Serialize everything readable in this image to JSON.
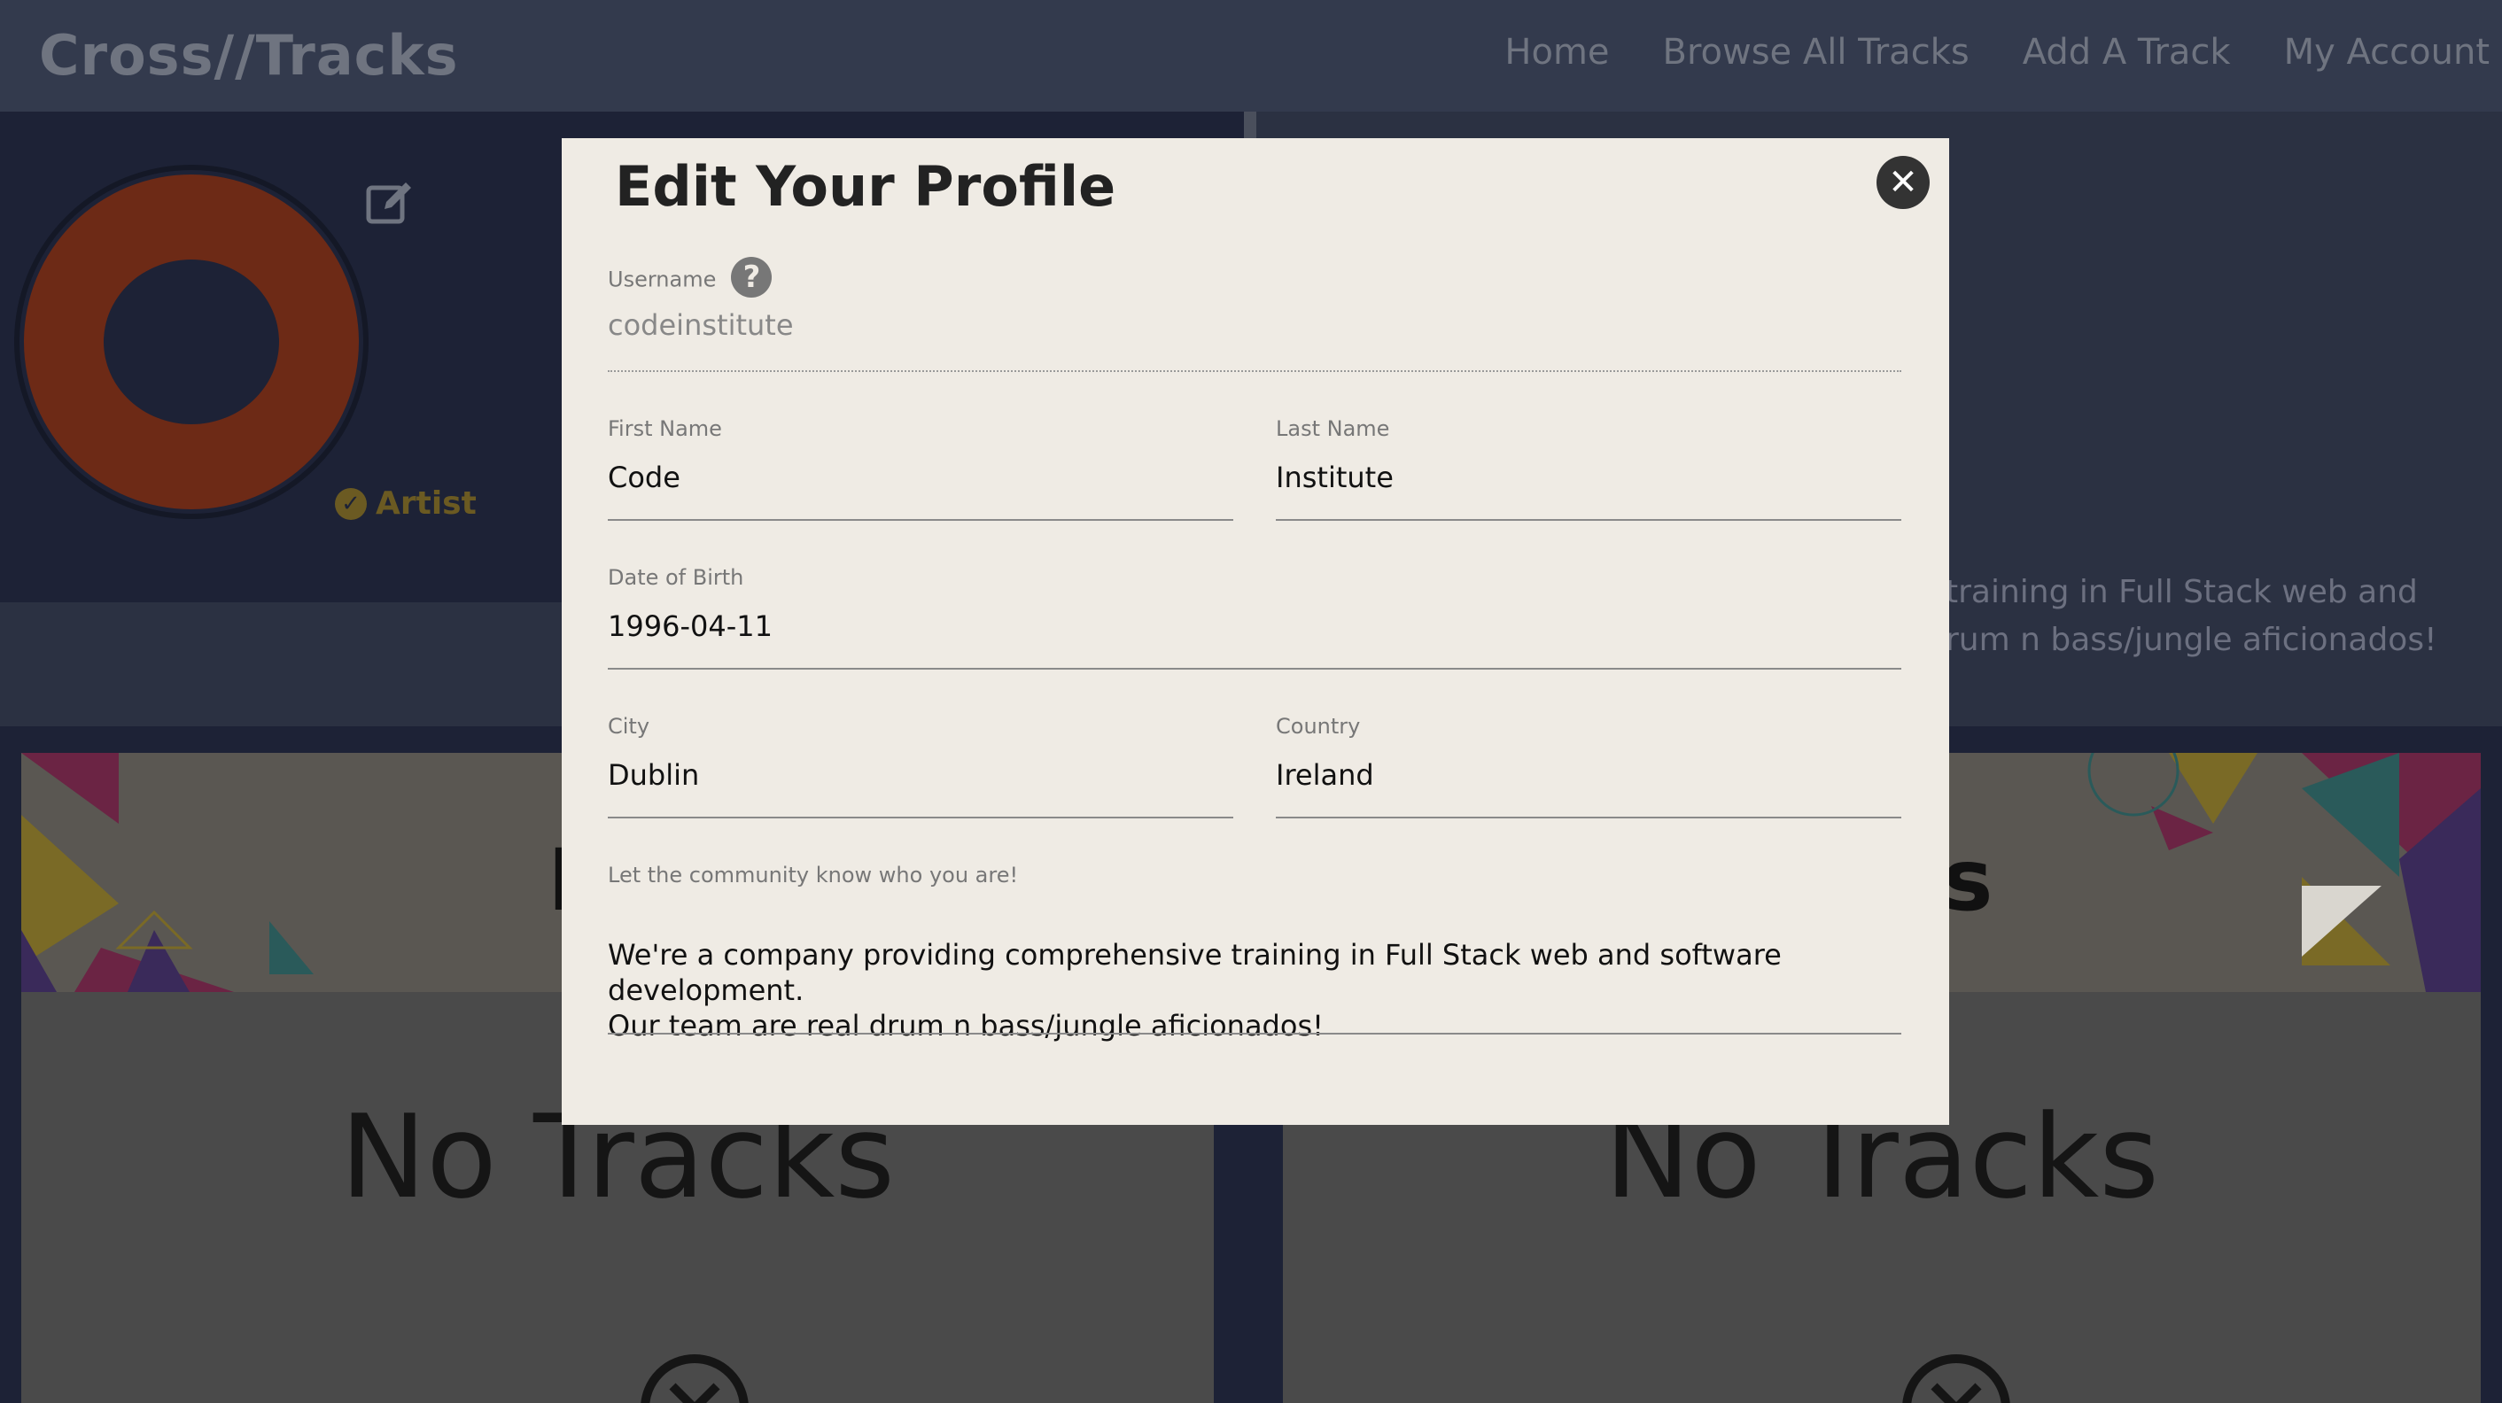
{
  "navbar": {
    "brand": "Cross//Tracks",
    "links": [
      "Home",
      "Browse All Tracks",
      "Add A Track",
      "My Account"
    ]
  },
  "profile": {
    "badge": "Artist",
    "bio_visible_line1": "training in Full Stack web and",
    "bio_visible_line2": "rum n bass/jungle aficionados!"
  },
  "tracks": {
    "left_heading": "My",
    "right_heading": "acks",
    "left_empty": "No Tracks",
    "right_empty": "No Tracks"
  },
  "modal": {
    "title": "Edit Your Profile",
    "username_label": "Username",
    "username_value": "codeinstitute",
    "first_name_label": "First Name",
    "first_name_value": "Code",
    "last_name_label": "Last Name",
    "last_name_value": "Institute",
    "dob_label": "Date of Birth",
    "dob_value": "1996-04-11",
    "city_label": "City",
    "city_value": "Dublin",
    "country_label": "Country",
    "country_value": "Ireland",
    "bio_label": "Let the community know who you are!",
    "bio_line1": "We're a company providing comprehensive training in Full Stack web and software development.",
    "bio_line2": "Our team are real drum n bass/jungle aficionados!"
  },
  "colors": {
    "nav_bg": "#333a4d",
    "panel_bg": "#1d2236",
    "modal_bg": "#efebe4",
    "avatar_ring": "#6d2a16",
    "badge": "#6b5a22"
  },
  "icons": {
    "edit": "edit-icon",
    "check": "check-circle-icon",
    "help": "question-circle-icon",
    "close": "close-circle-icon"
  }
}
